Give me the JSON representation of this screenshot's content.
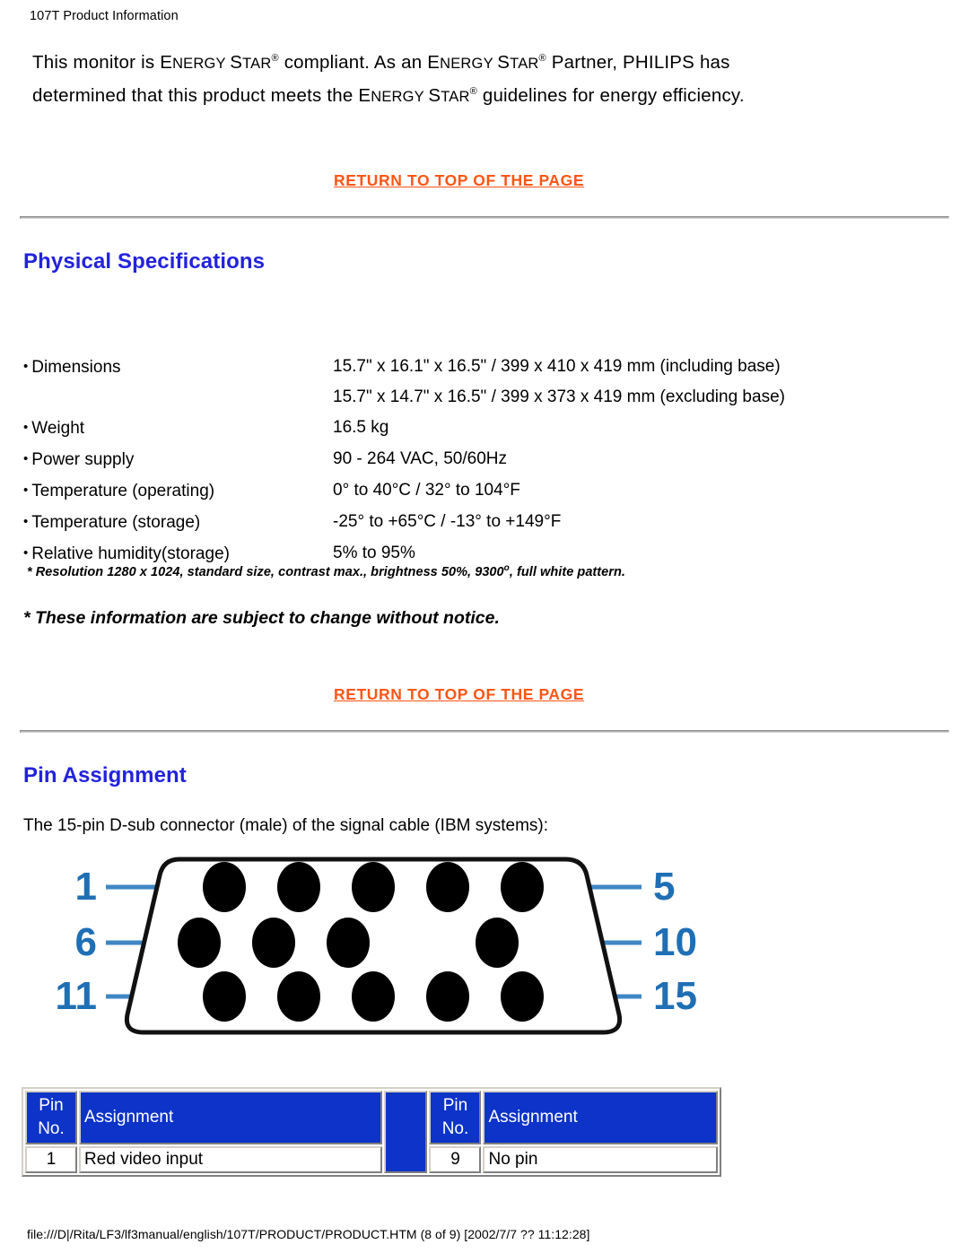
{
  "document": {
    "header": "107T Product Information",
    "footer": "file:///D|/Rita/LF3/lf3manual/english/107T/PRODUCT/PRODUCT.HTM (8 of 9) [2002/7/7 ?? 11:12:28]"
  },
  "colors": {
    "link": "#FF5515",
    "heading": "#2222DD",
    "table_header_bg": "#0D33C8",
    "table_header_text": "#FFFFFF",
    "diagram_label": "#1F6FB5",
    "rule": "#B0B0B0"
  },
  "intro": {
    "line1_a": "This monitor is ",
    "line1_energy1": "E",
    "line1_energy1_rest": "NERGY ",
    "line1_star1": "S",
    "line1_star1_rest": "TAR",
    "line1_b": " compliant. ",
    "line1_as": "A",
    "line1_as_rest": "s an ",
    "line1_energy2": "E",
    "line1_energy2_rest": "NERGY ",
    "line1_star2": "S",
    "line1_star2_rest": "TAR",
    "line1_c": " Partner, PHILIPS has",
    "line2_a": "determined that this product meets the ",
    "line2_energy3": "E",
    "line2_energy3_rest": "NERGY ",
    "line2_star3": "S",
    "line2_star3_rest": "TAR",
    "line2_b": " guidelines for energy efficiency.",
    "registered_mark": "®"
  },
  "links": {
    "return_to_top": "RETURN TO TOP OF THE PAGE"
  },
  "sections": {
    "physical_specifications": "Physical Specifications",
    "pin_assignment": "Pin Assignment"
  },
  "specs": {
    "rows": [
      {
        "label": "Dimensions",
        "values": [
          "15.7\" x 16.1\" x 16.5\" / 399 x 410 x 419 mm (including base)",
          "15.7\" x 14.7\" x 16.5\" / 399 x 373 x 419 mm (excluding base)"
        ]
      },
      {
        "label": "Weight",
        "values": [
          "16.5 kg"
        ]
      },
      {
        "label": "Power supply",
        "values": [
          "90 - 264 VAC, 50/60Hz"
        ]
      },
      {
        "label": "Temperature (operating)",
        "values": [
          "0° to 40°C / 32° to 104°F"
        ]
      },
      {
        "label": "Temperature (storage)",
        "values": [
          "-25° to +65°C / -13° to +149°F"
        ]
      },
      {
        "label": "Relative humidity(storage)",
        "values": [
          "5% to 95%"
        ]
      }
    ],
    "bullet_glyph": "•"
  },
  "footnotes": {
    "resolution_note_a": "* Resolution 1280 x 1024, standard size, contrast max., brightness 50%, 9300",
    "resolution_note_sup": "o",
    "resolution_note_b": ", full white pattern.",
    "change_note": "* These information are subject to change without notice."
  },
  "pin_section": {
    "intro": "The 15-pin D-sub connector (male) of the signal cable (IBM systems):",
    "diagram": {
      "left_labels": [
        "1",
        "6",
        "11"
      ],
      "right_labels": [
        "5",
        "10",
        "15"
      ],
      "rows": [
        {
          "pins": 5,
          "gap_index": -1
        },
        {
          "pins": 5,
          "gap_index": 3
        },
        {
          "pins": 5,
          "gap_index": -1
        }
      ]
    },
    "table": {
      "headers": {
        "pin_no_line1": "Pin",
        "pin_no_line2": "No.",
        "assignment": "Assignment"
      },
      "left_rows": [
        {
          "no": "1",
          "assignment": "Red video input"
        }
      ],
      "right_rows": [
        {
          "no": "9",
          "assignment": "No pin"
        }
      ]
    }
  }
}
